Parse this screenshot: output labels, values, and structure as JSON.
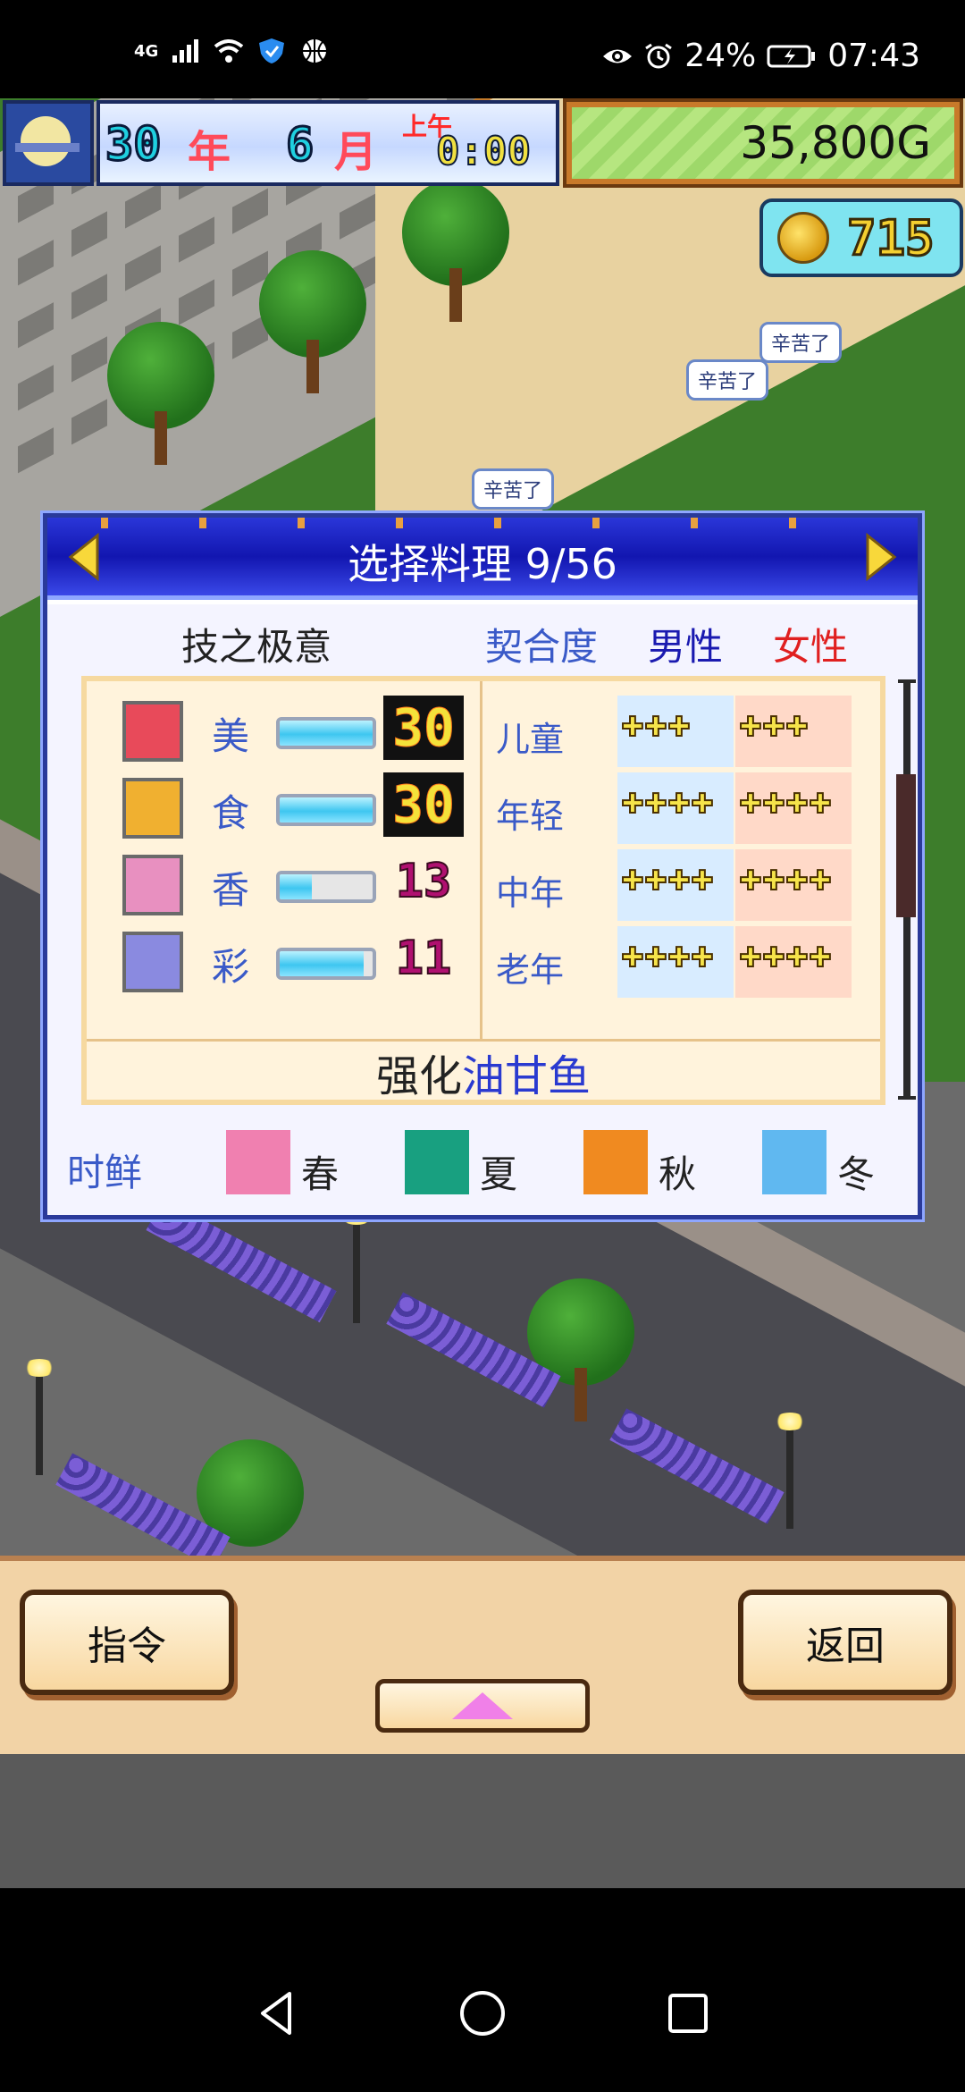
{
  "status_bar": {
    "network": "4G",
    "battery": "24%",
    "time": "07:43",
    "icons": [
      "signal-icon",
      "wifi-icon",
      "shield-icon",
      "basketball-icon",
      "eye-icon",
      "alarm-icon",
      "battery-icon"
    ]
  },
  "hud": {
    "year_num": "30",
    "year_unit": "年",
    "month_num": "6",
    "month_unit": "月",
    "ampm": "上午",
    "time": "0:00",
    "money": "35,800G",
    "coins": "715"
  },
  "scene": {
    "bubbles": [
      "辛苦了",
      "辛苦了",
      "辛苦了"
    ]
  },
  "dialog": {
    "title": "选择料理 9/56",
    "header": {
      "skill": "技之极意",
      "fit": "契合度",
      "male": "男性",
      "female": "女性"
    },
    "stats": [
      {
        "name": "美",
        "value": "30",
        "fill": 1.0,
        "icon": "beauty-icon",
        "color": "#e84a5a"
      },
      {
        "name": "食",
        "value": "30",
        "fill": 1.0,
        "icon": "taste-icon",
        "color": "#f0b030"
      },
      {
        "name": "香",
        "value": "13",
        "fill": 0.35,
        "icon": "aroma-icon",
        "color": "#e890c0"
      },
      {
        "name": "彩",
        "value": "11",
        "fill": 0.9,
        "icon": "color-icon",
        "color": "#8a8ae0"
      }
    ],
    "ages": [
      {
        "name": "儿童",
        "male_stars": 3,
        "female_stars": 3
      },
      {
        "name": "年轻",
        "male_stars": 4,
        "female_stars": 4
      },
      {
        "name": "中年",
        "male_stars": 4,
        "female_stars": 4
      },
      {
        "name": "老年",
        "male_stars": 4,
        "female_stars": 4
      }
    ],
    "enhance": {
      "label": "强化",
      "item": "油甘鱼"
    },
    "seasons": {
      "label": "时鲜",
      "items": [
        {
          "name": "春",
          "icon": "cherry-blossom-icon",
          "color": "#f080b0"
        },
        {
          "name": "夏",
          "icon": "leaf-icon",
          "color": "#18a080"
        },
        {
          "name": "秋",
          "icon": "maple-leaf-icon",
          "color": "#f08a20"
        },
        {
          "name": "冬",
          "icon": "snowflake-icon",
          "color": "#60b8f0"
        }
      ]
    }
  },
  "bottom": {
    "command_label": "指令",
    "back_label": "返回"
  }
}
